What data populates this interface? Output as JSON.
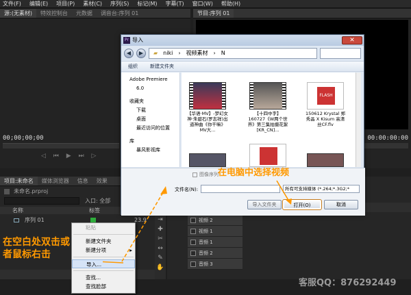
{
  "menubar": [
    "文件(F)",
    "编辑(E)",
    "项目(P)",
    "素材(C)",
    "序列(S)",
    "标记(M)",
    "字幕(T)",
    "窗口(W)",
    "帮助(H)"
  ],
  "source_panel": {
    "tabs": [
      "源:(无素材)",
      "特效控制台",
      "元数据",
      "调音台:序列 01"
    ],
    "timecode_left": "00;00;00;00"
  },
  "program_panel": {
    "tab": "节目:序列 01",
    "timecode": "00:00:00:00"
  },
  "project_panel": {
    "tabs": [
      "项目:未命名",
      "媒体浏览器",
      "信息",
      "效果"
    ],
    "project_file": "未命名.prproj",
    "entry_label": "入口:",
    "entry_value": "全部",
    "col_name": "名称",
    "col_label": "标签",
    "sequence_item": "序列 01",
    "sequence_value": "23.9"
  },
  "timeline": {
    "tracks": [
      "视频 2",
      "视频 1",
      "音频 1",
      "音频 2",
      "音频 3"
    ]
  },
  "dialog": {
    "title": "导入",
    "breadcrumb": [
      "niki",
      "视频素材",
      "N"
    ],
    "toolbar": [
      "组织",
      "新建文件夹"
    ],
    "nav": [
      {
        "label": "Adobe Premiere",
        "sub": false
      },
      {
        "label": "6.0",
        "sub": true
      },
      {
        "label": "收藏夹",
        "sub": false
      },
      {
        "label": "下载",
        "sub": true
      },
      {
        "label": "桌面",
        "sub": true
      },
      {
        "label": "最近访问的位置",
        "sub": true
      },
      {
        "label": "库",
        "sub": false
      },
      {
        "label": "暴风影视库",
        "sub": true
      }
    ],
    "files": [
      "【华语·MV】-梦幻女神·朱碧石(罗志祥)出道神曲《你干嘛》MV大...",
      "【十四中字】160727《W两个世界》第三集拍摄花絮[KR_CN]...",
      "150612 Krystal 郑秀晶 X Kisum 高清丝CF.flv"
    ],
    "image_sequence": "图像序列",
    "filename_label": "文件名(N):",
    "filter": "所有可支持媒体 (*.264;*.3G2;*",
    "import_folder_btn": "导入文件夹",
    "open_btn": "打开(O)",
    "cancel_btn": "取消"
  },
  "context_menu": [
    "粘贴",
    "新建文件夹",
    "新建分项",
    "导入...",
    "查找...",
    "查找脸部"
  ],
  "annotations": {
    "left": "在空白处双击或者鼠标右击",
    "dialog": "在电脑中选择视频",
    "watermark": "客服QQ：876292449"
  }
}
